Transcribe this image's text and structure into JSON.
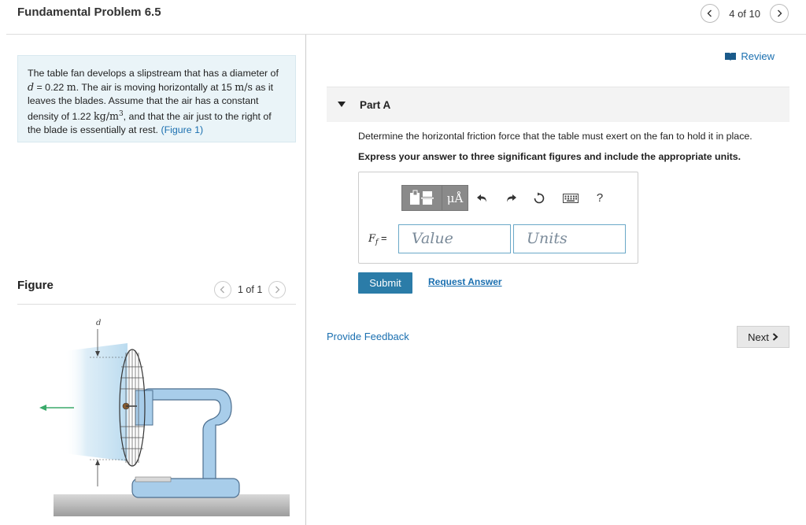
{
  "header": {
    "title": "Fundamental Problem 6.5",
    "pager": "4 of 10"
  },
  "problem": {
    "t1": "The table fan develops a slipstream that has a diameter of ",
    "d_var": "d",
    "d_eq": " = 0.22 ",
    "d_unit": "m",
    "t2": ". The air is moving horizontally at 15 ",
    "v_unit": "m/s",
    "t3": " as it leaves the blades. Assume that the air has a constant density of 1.22 ",
    "rho_unit": "kg/m",
    "rho_exp": "3",
    "t4": ", and that the air just to the right of the blade is essentially at rest. ",
    "figure_link": "(Figure 1)"
  },
  "figure": {
    "label": "Figure",
    "pager": "1 of 1",
    "d_label": "d"
  },
  "review": "Review",
  "part": {
    "label": "Part A",
    "question": "Determine the horizontal friction force that the table must exert on the fan to hold it in place.",
    "instruction": "Express your answer to three significant figures and include the appropriate units."
  },
  "answer": {
    "var": "F",
    "var_sub": "f",
    "eq": " =",
    "mu_label": "μÅ",
    "help": "?",
    "value_placeholder": "Value",
    "units_placeholder": "Units"
  },
  "buttons": {
    "submit": "Submit",
    "request": "Request Answer",
    "feedback": "Provide Feedback",
    "next": "Next"
  },
  "colors": {
    "link": "#1a6fb0",
    "submit_bg": "#2b7ca8",
    "problem_bg": "#eaf4f8",
    "toolbar_bg": "#8a8a8a",
    "arrow_green": "#3aaa6a"
  },
  "icons": [
    "chevron-left-icon",
    "chevron-right-icon",
    "book-icon",
    "templates-icon",
    "undo-icon",
    "redo-icon",
    "reset-icon",
    "keyboard-icon"
  ]
}
